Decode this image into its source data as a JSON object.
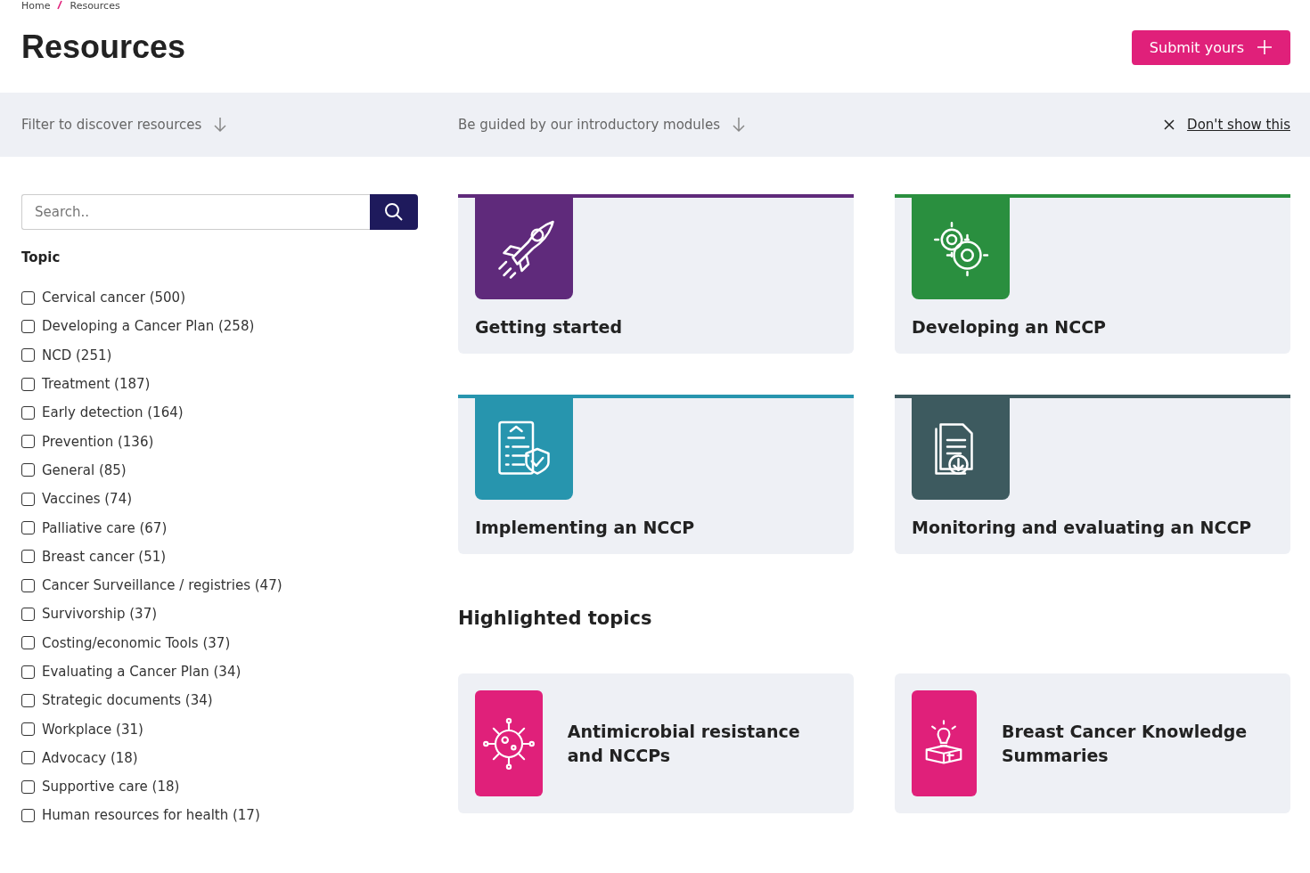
{
  "breadcrumb": [
    "Home",
    "Resources"
  ],
  "title": "Resources",
  "submit_button": "Submit yours",
  "filter_bar": {
    "filter_link": "Filter to discover resources",
    "guided_link": "Be guided by our introductory modules",
    "dismiss": "Don't show this"
  },
  "search": {
    "placeholder": "Search.."
  },
  "topic": {
    "heading": "Topic",
    "items": [
      {
        "label": "Cervical cancer (500)",
        "checked": false
      },
      {
        "label": "Developing a Cancer Plan (258)",
        "checked": false
      },
      {
        "label": "NCD (251)",
        "checked": false
      },
      {
        "label": "Treatment (187)",
        "checked": false
      },
      {
        "label": "Early detection (164)",
        "checked": false
      },
      {
        "label": "Prevention (136)",
        "checked": false
      },
      {
        "label": "General (85)",
        "checked": false
      },
      {
        "label": "Vaccines (74)",
        "checked": false
      },
      {
        "label": "Palliative care (67)",
        "checked": false
      },
      {
        "label": "Breast cancer (51)",
        "checked": false
      },
      {
        "label": "Cancer Surveillance / registries (47)",
        "checked": false
      },
      {
        "label": "Survivorship (37)",
        "checked": false
      },
      {
        "label": "Costing/economic Tools (37)",
        "checked": false
      },
      {
        "label": "Evaluating a Cancer Plan (34)",
        "checked": false
      },
      {
        "label": "Strategic documents (34)",
        "checked": false
      },
      {
        "label": "Workplace (31)",
        "checked": false
      },
      {
        "label": "Advocacy (18)",
        "checked": false
      },
      {
        "label": "Supportive care (18)",
        "checked": false
      },
      {
        "label": "Human resources for health (17)",
        "checked": false
      }
    ]
  },
  "modules": [
    {
      "title": "Getting started",
      "kind": "rocket",
      "color": "#5f2a7b"
    },
    {
      "title": "Developing an NCCP",
      "kind": "gears",
      "color": "#2a8f3f"
    },
    {
      "title": "Implementing an NCCP",
      "kind": "checklist",
      "color": "#2795ae"
    },
    {
      "title": "Monitoring and evaluating an NCCP",
      "kind": "download",
      "color": "#3d5a5f"
    }
  ],
  "highlighted": {
    "heading": "Highlighted topics",
    "items": [
      {
        "title": "Antimicrobial resistance and NCCPs",
        "kind": "virus"
      },
      {
        "title": "Breast Cancer Knowledge Summaries",
        "kind": "bulb"
      }
    ]
  }
}
